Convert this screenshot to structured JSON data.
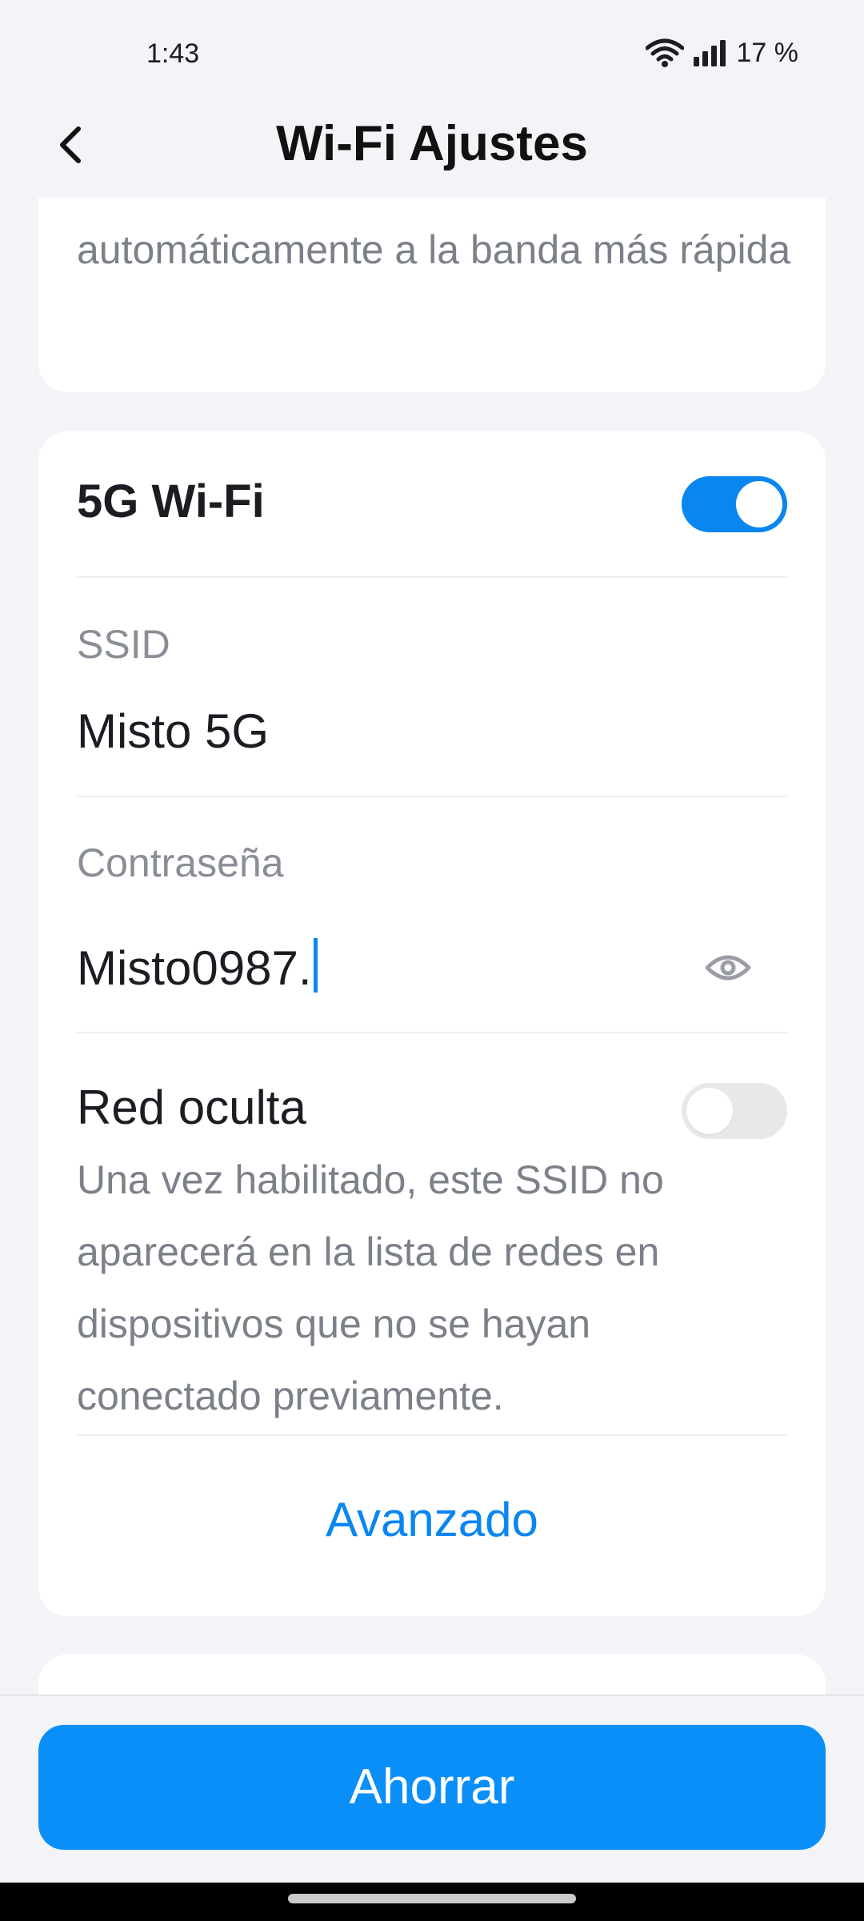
{
  "status_bar": {
    "time": "1:43",
    "battery": "17 %",
    "icons": [
      "wifi-icon",
      "signal-icon"
    ]
  },
  "header": {
    "title": "Wi-Fi Ajustes",
    "back_icon": "chevron-left-icon"
  },
  "smart_connect_card": {
    "description": "automáticamente a la banda más rápida"
  },
  "wifi_5g": {
    "title": "5G Wi-Fi",
    "enabled": true,
    "ssid_label": "SSID",
    "ssid_value": "Misto 5G",
    "password_label": "Contraseña",
    "password_value": "Misto0987.",
    "password_visibility_icon": "eye-icon",
    "hidden_network_label": "Red oculta",
    "hidden_network_enabled": false,
    "hidden_network_description": "Una vez habilitado, este SSID no aparecerá en la lista de redes en dispositivos que no se hayan conectado previamente.",
    "advanced_link": "Avanzado"
  },
  "footer": {
    "save_label": "Ahorrar"
  },
  "colors": {
    "accent": "#0a86f0",
    "button": "#0a8ef8",
    "background": "#f2f4f7"
  }
}
